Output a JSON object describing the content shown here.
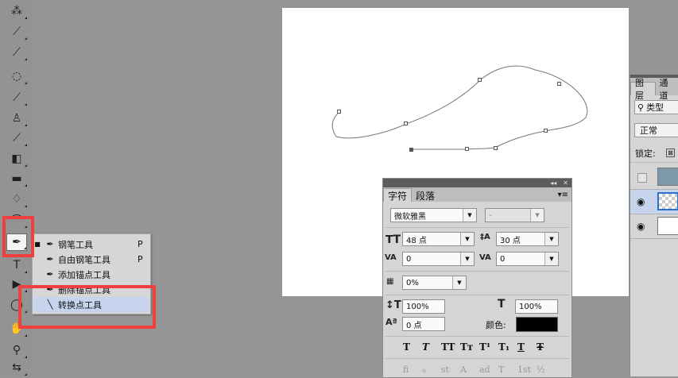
{
  "toolbar": {
    "tools": [
      {
        "name": "quick-selection-tool",
        "glyph": "⁂"
      },
      {
        "name": "crop-tool",
        "glyph": "⟋"
      },
      {
        "name": "eyedropper-tool",
        "glyph": "⟋"
      },
      {
        "name": "spot-healing-tool",
        "glyph": "◌"
      },
      {
        "name": "brush-tool",
        "glyph": "⟋"
      },
      {
        "name": "clone-stamp-tool",
        "glyph": "♙"
      },
      {
        "name": "history-brush-tool",
        "glyph": "⟋"
      },
      {
        "name": "eraser-tool",
        "glyph": "◧"
      },
      {
        "name": "gradient-tool",
        "glyph": "▬"
      },
      {
        "name": "blur-tool",
        "glyph": "♢"
      },
      {
        "name": "dodge-tool",
        "glyph": "⌒"
      },
      {
        "name": "pen-tool",
        "glyph": "✒"
      },
      {
        "name": "type-tool",
        "glyph": "T"
      },
      {
        "name": "path-selection-tool",
        "glyph": "▶"
      },
      {
        "name": "ellipse-tool",
        "glyph": "◯"
      },
      {
        "name": "hand-tool",
        "glyph": "✋"
      },
      {
        "name": "zoom-tool",
        "glyph": "⚲"
      },
      {
        "name": "swap-colors-tool",
        "glyph": "⇆"
      }
    ]
  },
  "flyout": {
    "items": [
      {
        "label": "钢笔工具",
        "shortcut": "P",
        "active": true,
        "selected": false
      },
      {
        "label": "自由钢笔工具",
        "shortcut": "P",
        "active": false,
        "selected": false
      },
      {
        "label": "添加锚点工具",
        "shortcut": "",
        "active": false,
        "selected": false
      },
      {
        "label": "删除锚点工具",
        "shortcut": "",
        "active": false,
        "selected": false
      },
      {
        "label": "转换点工具",
        "shortcut": "",
        "active": false,
        "selected": true
      }
    ]
  },
  "character_panel": {
    "tabs": [
      "字符",
      "段落"
    ],
    "font_family": "微软雅黑",
    "font_style": "-",
    "font_size": "48 点",
    "leading": "30 点",
    "kerning": "0",
    "tracking": "0",
    "scale_percent": "0%",
    "vertical_scale": "100%",
    "horizontal_scale": "100%",
    "baseline_shift": "0 点",
    "color_label": "颜色:",
    "text_color": "#000000",
    "style_buttons": [
      "T",
      "T",
      "TT",
      "Tт",
      "T¹",
      "T₁",
      "T",
      "Ŧ"
    ],
    "opentype_buttons": [
      "fi",
      "ℴ",
      "st",
      "A",
      "ad",
      "T",
      "1st",
      "½"
    ]
  },
  "layers_panel": {
    "tabs": [
      "图层",
      "通道"
    ],
    "filter_label": "类型",
    "blend_mode": "正常",
    "lock_label": "锁定:"
  },
  "colors": {
    "accent_red": "#ef3f3f",
    "selection_blue": "#c6d4ee"
  }
}
